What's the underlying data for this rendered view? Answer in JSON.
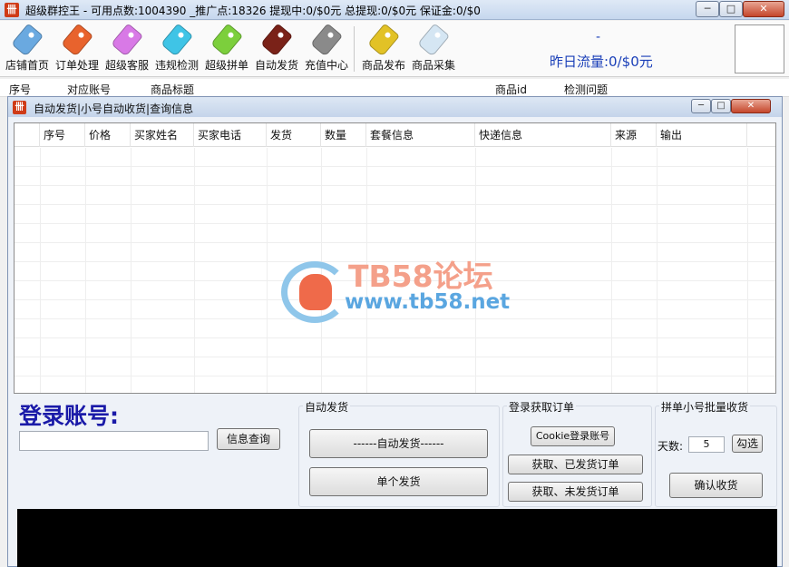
{
  "window": {
    "icon_glyph": "卌",
    "title": "超级群控王 - 可用点数:1004390 _推广点:18326  提现中:0/$0元  总提现:0/$0元  保证金:0/$0",
    "min_glyph": "─",
    "max_glyph": "□",
    "close_glyph": "✕"
  },
  "toolbar": {
    "items": [
      {
        "label": "店铺首页",
        "icon": "tag-icon",
        "color": "#6aa9e0"
      },
      {
        "label": "订单处理",
        "icon": "tag-icon",
        "color": "#e8632d"
      },
      {
        "label": "超级客服",
        "icon": "tag-icon",
        "color": "#d879e6"
      },
      {
        "label": "违规检测",
        "icon": "tag-icon",
        "color": "#3fc4e6"
      },
      {
        "label": "超级拼单",
        "icon": "tag-icon",
        "color": "#7ccf3c"
      },
      {
        "label": "自动发货",
        "icon": "tag-icon",
        "color": "#7a2218"
      },
      {
        "label": "充值中心",
        "icon": "tag-icon",
        "color": "#8a8a8a"
      },
      {
        "label": "商品发布",
        "icon": "tag-icon",
        "color": "#e2c226"
      },
      {
        "label": "商品采集",
        "icon": "tag-icon",
        "color": "#d5e6f3"
      }
    ],
    "dash": "-",
    "traffic": "昨日流量:0/$0元"
  },
  "background_list": {
    "columns": [
      "序号",
      "对应账号",
      "商品标题",
      "商品id",
      "检测问题"
    ]
  },
  "inner_window": {
    "icon_glyph": "卌",
    "title": "自动发货|小号自动收货|查询信息",
    "min_glyph": "─",
    "max_glyph": "□",
    "close_glyph": "✕"
  },
  "grid": {
    "columns": [
      "序号",
      "价格",
      "买家姓名",
      "买家电话",
      "发货",
      "数量",
      "套餐信息",
      "快递信息",
      "来源",
      "输出"
    ]
  },
  "watermark": {
    "title": "TB58论坛",
    "url": "www.tb58.net"
  },
  "login": {
    "label": "登录账号:",
    "input_value": "",
    "query_button": "信息查询"
  },
  "auto_ship": {
    "title": "自动发货",
    "auto_button": "------自动发货------",
    "single_button": "单个发货"
  },
  "fetch_orders": {
    "title": "登录获取订单",
    "cookie_button": "Cookie登录账号",
    "shipped_button": "获取、已发货订单",
    "unshipped_button": "获取、未发货订单"
  },
  "batch_receive": {
    "title": "拼单小号批量收货",
    "days_label": "天数:",
    "days_value": "5",
    "check_button": "勾选",
    "confirm_button": "确认收货"
  }
}
